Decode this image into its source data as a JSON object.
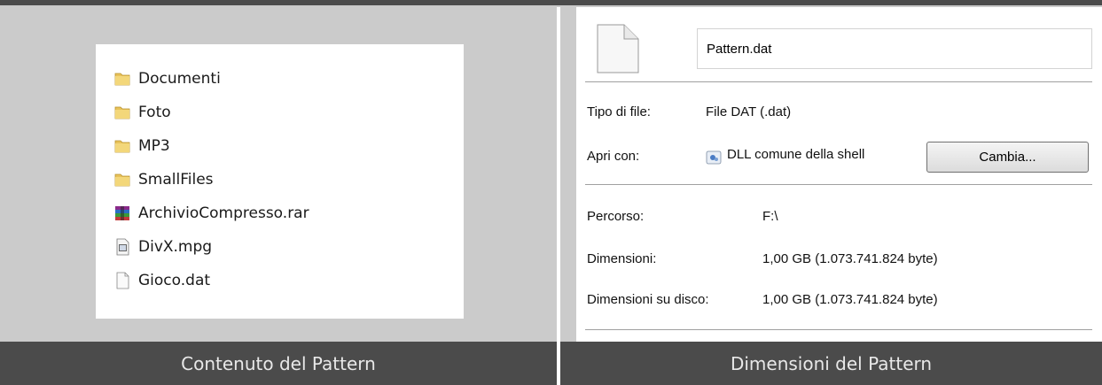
{
  "explorer": {
    "items": [
      {
        "name": "Documenti",
        "icon": "folder-icon"
      },
      {
        "name": "Foto",
        "icon": "folder-icon"
      },
      {
        "name": "MP3",
        "icon": "folder-icon"
      },
      {
        "name": "SmallFiles",
        "icon": "folder-icon"
      },
      {
        "name": "ArchivioCompresso.rar",
        "icon": "rar-archive-icon"
      },
      {
        "name": "DivX.mpg",
        "icon": "video-file-icon"
      },
      {
        "name": "Gioco.dat",
        "icon": "blank-file-icon"
      }
    ]
  },
  "properties": {
    "file_name": "Pattern.dat",
    "type_label": "Tipo di file:",
    "type_value": "File DAT (.dat)",
    "open_with_label": "Apri con:",
    "open_with_value": "DLL comune della shell",
    "change_button": "Cambia...",
    "path_label": "Percorso:",
    "path_value": "F:\\",
    "size_label": "Dimensioni:",
    "size_value": "1,00 GB (1.073.741.824 byte)",
    "size_on_disk_label": "Dimensioni su disco:",
    "size_on_disk_value": "1,00 GB (1.073.741.824 byte)"
  },
  "captions": {
    "left": "Contenuto del Pattern",
    "right": "Dimensioni del Pattern"
  },
  "colors": {
    "caption_bg": "#4b4b4b",
    "panel_bg": "#cbcbcb",
    "folder": "#e8c25a"
  }
}
